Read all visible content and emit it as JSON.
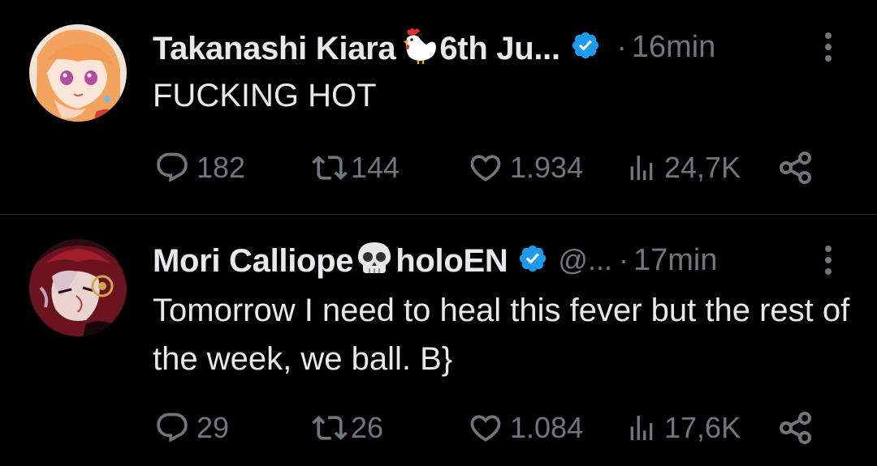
{
  "colors": {
    "background": "#000000",
    "text": "#e7e9ea",
    "muted": "#71767b",
    "verified": "#1d9bf0",
    "divider": "#2f3336"
  },
  "tweets": [
    {
      "display_name_part1": "Takanashi Kiara",
      "name_emoji": "chicken",
      "display_name_part2": "6th Ju...",
      "handle": "",
      "separator": "·",
      "time": "16min",
      "text": "FUCKING HOT",
      "replies": "182",
      "retweets": "144",
      "likes": "1.934",
      "views": "24,7K"
    },
    {
      "display_name_part1": "Mori Calliope",
      "name_emoji": "skull",
      "display_name_part2": "holoEN",
      "handle": "@...",
      "separator": "·",
      "time": "17min",
      "text": "Tomorrow I need to heal this fever but the rest of the week, we ball. B}",
      "replies": "29",
      "retweets": "26",
      "likes": "1.084",
      "views": "17,6K"
    }
  ],
  "icons": {
    "reply": "reply-icon",
    "retweet": "retweet-icon",
    "like": "heart-icon",
    "views": "views-icon",
    "share": "share-icon",
    "more": "more-icon",
    "verified": "verified-badge-icon"
  }
}
